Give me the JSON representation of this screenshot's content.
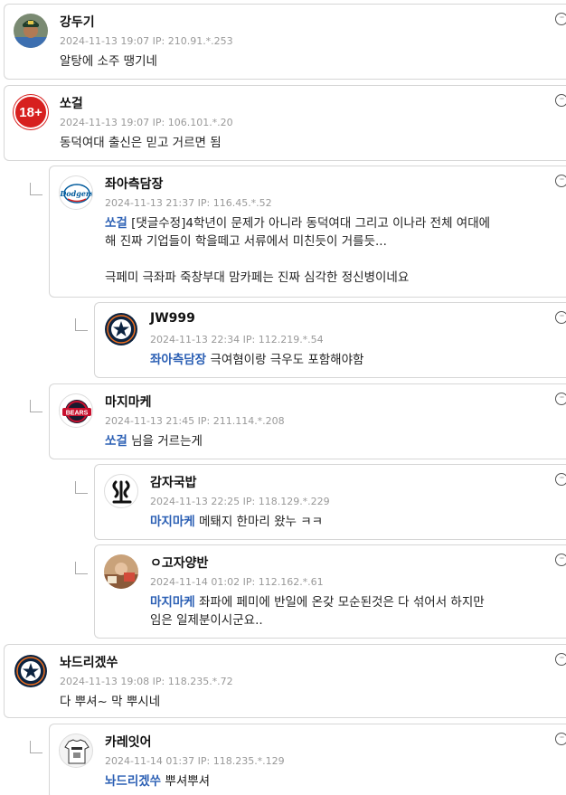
{
  "comments": [
    {
      "nickname": "강두기",
      "meta": "2024-11-13 19:07  IP: 210.91.*.253",
      "mention": "",
      "text": "알탕에 소주 땡기네",
      "more": "···"
    },
    {
      "nickname": "쏘걸",
      "meta": "2024-11-13 19:07  IP: 106.101.*.20",
      "mention": "",
      "text": "동덕여대 출신은 믿고 거르면 됨",
      "avatar_text": "18+",
      "more": "···"
    },
    {
      "nickname": "좌아측담장",
      "meta": "2024-11-13 21:37  IP: 116.45.*.52",
      "mention": "쏘걸",
      "text": " [댓글수정]4학년이 문제가 아니라 동덕여대 그리고 이나라 전체 여대에\n해 진짜 기업들이 학을떼고 서류에서 미친듯이 거를듯...\n\n극페미 극좌파 죽창부대 맘카페는 진짜 심각한 정신병이네요",
      "avatar_text": "Dodgers",
      "more": "···"
    },
    {
      "nickname": "JW999",
      "meta": "2024-11-13 22:34  IP: 112.219.*.54",
      "mention": "좌아측담장",
      "text": " 극여혐이랑 극우도 포함해야함",
      "more": "···"
    },
    {
      "nickname": "마지마케",
      "meta": "2024-11-13 21:45  IP: 211.114.*.208",
      "mention": "쏘걸",
      "text": " 님을 거르는게",
      "avatar_text": "BEARS",
      "more": "···"
    },
    {
      "nickname": "감자국밥",
      "meta": "2024-11-13 22:25  IP: 118.129.*.229",
      "mention": "마지마케",
      "text": " 메퇘지 한마리 왔누 ㅋㅋ",
      "more": "···"
    },
    {
      "nickname": "ㅇ고자양반",
      "meta": "2024-11-14 01:02  IP: 112.162.*.61",
      "mention": "마지마케",
      "text": " 좌파에 페미에 반일에 온갖 모순된것은 다 섞어서 하지만 \n임은 일제분이시군요..",
      "more": "···"
    },
    {
      "nickname": "놔드리겠쑤",
      "meta": "2024-11-13 19:08  IP: 118.235.*.72",
      "mention": "",
      "text": "다 뿌셔~ 막 뿌시네",
      "more": "···"
    },
    {
      "nickname": "카레잇어",
      "meta": "2024-11-14 01:37  IP: 118.235.*.129",
      "mention": "놔드리겠쑤",
      "text": " 뿌셔뿌셔",
      "more": "···"
    }
  ],
  "colors": {
    "mention": "#2b5fb4",
    "meta": "#999999",
    "border": "#d6d6d6",
    "astros_navy": "#0c2340",
    "astros_orange": "#eb6e1f",
    "dodgers_blue": "#005a9c",
    "bears_red": "#c8102e"
  }
}
